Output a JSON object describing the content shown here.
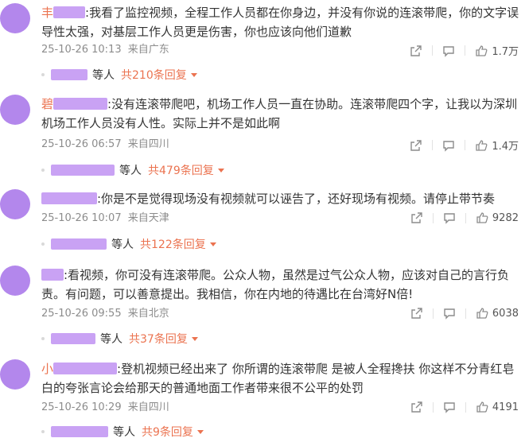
{
  "comments": [
    {
      "prefix": "丰",
      "text": ":我看了监控视频，全程工作人员都在你身边，并没有你说的连滚带爬，你的文字误导性太强，对基层工作人员更是伤害，你也应该向他们道歉",
      "time": "25-10-26 10:13",
      "location": "来自广东",
      "likes": "1.7万",
      "reply_suffix": "等人",
      "reply_count": "共210条回复"
    },
    {
      "prefix": "碧",
      "text": ":没有连滚带爬吧，机场工作人员一直在协助。连滚带爬四个字，让我以为深圳机场工作人员没有人性。实际上并不是如此啊",
      "time": "25-10-26 06:57",
      "location": "来自四川",
      "likes": "1.4万",
      "reply_suffix": "等人",
      "reply_count": "共479条回复"
    },
    {
      "prefix": "",
      "text": ":你是不是觉得现场没有视频就可以诬告了，还好现场有视频。请停止带节奏",
      "time": "25-10-26 10:07",
      "location": "来自天津",
      "likes": "9282",
      "reply_suffix": "等人",
      "reply_count": "共122条回复"
    },
    {
      "prefix": "",
      "text": ":看视频，你可没有连滚带爬。公众人物，虽然是过气公众人物，应该对自己的言行负责。有问题，可以善意提出。我相信，你在内地的待遇比在台湾好N倍!",
      "time": "25-10-26 09:55",
      "location": "来自北京",
      "likes": "6038",
      "reply_suffix": "等人",
      "reply_count": "共37条回复"
    },
    {
      "prefix": "小",
      "text": ":登机视频已经出来了 你所谓的连滚带爬 是被人全程搀扶 你这样不分青红皂白的夸张言论会给那天的普通地面工作者带来很不公平的处罚",
      "time": "25-10-26 10:29",
      "location": "来自四川",
      "likes": "4191",
      "reply_suffix": "等人",
      "reply_count": "共9条回复"
    }
  ]
}
